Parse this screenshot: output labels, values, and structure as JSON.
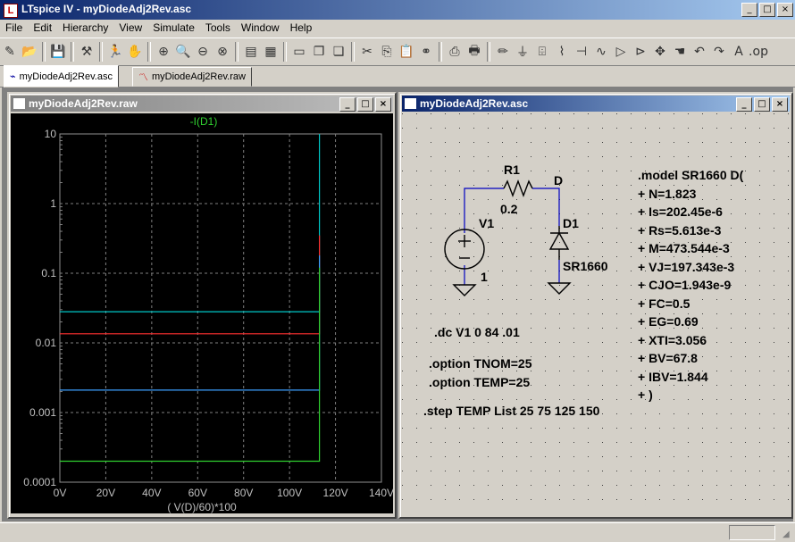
{
  "app": {
    "title": "LTspice IV - myDiodeAdj2Rev.asc"
  },
  "menu": [
    "File",
    "Edit",
    "Hierarchy",
    "View",
    "Simulate",
    "Tools",
    "Window",
    "Help"
  ],
  "toolbar_icons": [
    "new-schematic-icon",
    "open-icon",
    "save-icon",
    "control-panel-icon",
    "run-icon",
    "halt-icon",
    "zoom-in-icon",
    "zoom-pan-icon",
    "zoom-out-icon",
    "zoom-cancel-icon",
    "autorange-icon",
    "grid-icon",
    "tile-icon",
    "cascade-icon",
    "window-icon",
    "cut-icon",
    "copy-icon",
    "paste-icon",
    "find-icon",
    "print-setup-icon",
    "print-icon",
    "wire-icon",
    "ground-icon",
    "label-icon",
    "resistor-icon",
    "capacitor-icon",
    "inductor-icon",
    "diode-icon",
    "component-icon",
    "move-icon",
    "drag-icon",
    "undo-icon",
    "redo-icon",
    "text-icon",
    "spice-directive-icon"
  ],
  "tabs": [
    {
      "label": "myDiodeAdj2Rev.asc",
      "active": true
    },
    {
      "label": "myDiodeAdj2Rev.raw",
      "active": false
    }
  ],
  "plot_window": {
    "title": "myDiodeAdj2Rev.raw",
    "trace_label": "-I(D1)",
    "xlabel": "( V(D)/60)*100",
    "xticks": [
      "0V",
      "20V",
      "40V",
      "60V",
      "80V",
      "100V",
      "120V",
      "140V"
    ],
    "yticks": [
      "10",
      "1",
      "0.1",
      "0.01",
      "0.001",
      "0.0001"
    ]
  },
  "chart_data": {
    "type": "line",
    "title": "-I(D1)",
    "xlabel": "( V(D)/60)*100",
    "ylabel": "",
    "xlim": [
      0,
      140
    ],
    "ylim": [
      0.0001,
      10
    ],
    "yscale": "log",
    "grid": true,
    "legend": "none",
    "series": [
      {
        "color": "#00c8c8",
        "points": [
          [
            0,
            0.028
          ],
          [
            113,
            0.028
          ],
          [
            113,
            10
          ]
        ]
      },
      {
        "color": "#ff3030",
        "points": [
          [
            0,
            0.0135
          ],
          [
            113,
            0.0135
          ],
          [
            113,
            0.35
          ]
        ]
      },
      {
        "color": "#3ca0ff",
        "points": [
          [
            0,
            0.0021
          ],
          [
            113,
            0.0021
          ],
          [
            113,
            0.18
          ]
        ]
      },
      {
        "color": "#30d030",
        "points": [
          [
            0,
            0.0002
          ],
          [
            113,
            0.0002
          ],
          [
            113,
            0.12
          ]
        ]
      }
    ]
  },
  "schematic_window": {
    "title": "myDiodeAdj2Rev.asc",
    "labels": {
      "r1": "R1",
      "r1_value": "0.2",
      "node_d": "D",
      "d1": "D1",
      "d1_model": "SR1660",
      "v1": "V1",
      "v1_value": "1"
    },
    "directives": {
      "dc": ".dc V1 0 84 .01",
      "tnom": ".option TNOM=25",
      "temp": ".option TEMP=25",
      "step": ".step TEMP List 25 75 125 150"
    },
    "model_lines": [
      ".model SR1660 D(",
      "+ N=1.823",
      "+ Is=202.45e-6",
      "+ Rs=5.613e-3",
      "+ M=473.544e-3",
      "+ VJ=197.343e-3",
      "+ CJO=1.943e-9",
      "+ FC=0.5",
      "+ EG=0.69",
      "+ XTI=3.056",
      "+ BV=67.8",
      "+ IBV=1.844",
      "+ )"
    ]
  }
}
